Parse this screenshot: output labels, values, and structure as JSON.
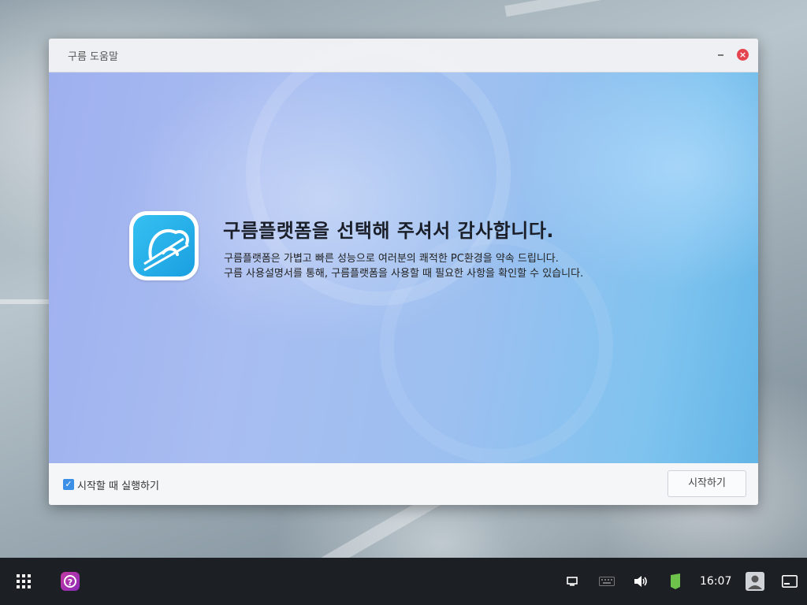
{
  "window": {
    "title": "구름 도움말",
    "close_symbol": "×"
  },
  "hero": {
    "headline": "구름플랫폼을 선택해 주셔서 감사합니다.",
    "description_line1": "구름플랫폼은 가볍고 빠른 성능으로 여러분의 쾌적한 PC환경을 약속 드립니다.",
    "description_line2": "구름 사용설명서를 통해, 구름플랫폼을 사용할 때 필요한 사항을 확인할 수 있습니다."
  },
  "footer": {
    "autostart_label": "시작할 때 실행하기",
    "autostart_checked": true,
    "start_button": "시작하기"
  },
  "taskbar": {
    "clock": "16:07",
    "icons": [
      "apps-grid-icon",
      "help-app-icon",
      "desktop-icon",
      "keyboard-icon",
      "volume-icon",
      "battery-icon",
      "user-icon",
      "show-desktop-icon"
    ]
  },
  "colors": {
    "accent": "#3b8fe6",
    "close": "#e5454f",
    "taskbar": "#1c1f24"
  }
}
